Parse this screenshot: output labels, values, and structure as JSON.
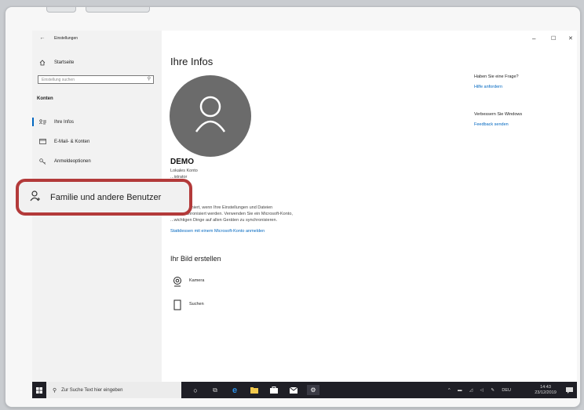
{
  "window": {
    "title": "Einstellungen",
    "back_icon": "←",
    "minimize": "–",
    "maximize": "☐",
    "close": "✕"
  },
  "sidebar": {
    "home_label": "Startseite",
    "search_placeholder": "Einstellung suchen",
    "section_label": "Konten",
    "items": [
      {
        "label": "Ihre Infos",
        "icon": "person-list-icon"
      },
      {
        "label": "E-Mail- & Konten",
        "icon": "mail-icon"
      },
      {
        "label": "Anmeldeoptionen",
        "icon": "key-icon"
      }
    ]
  },
  "main": {
    "title": "Ihre Infos",
    "account_name": "DEMO",
    "account_type": "Lokales Konto",
    "account_role": "...istrator",
    "info_line1": "...wird optimiert, wenn Ihre Einstellungen und Dateien",
    "info_line2": "...ch synchronisiert werden. Verwenden Sie ein Microsoft-Konto,",
    "info_line3": "...wichtigen Dinge auf allen Geräten zu synchronisieren.",
    "ms_link": "Stattdessen mit einem Microsoft-Konto anmelden",
    "picture_title": "Ihr Bild erstellen",
    "camera_label": "Kamera",
    "browse_label": "Suchen"
  },
  "right_panel": {
    "q_title": "Haben Sie eine Frage?",
    "q_link": "Hilfe anfordern",
    "improve_title": "Verbessern Sie Windows",
    "improve_link": "Feedback senden"
  },
  "callout": {
    "label": "Familie und andere Benutzer"
  },
  "taskbar": {
    "search_text": "Zur Suche Text hier eingeben",
    "language": "DEU",
    "time": "14:43",
    "date": "23/12/2019"
  },
  "colors": {
    "accent": "#0067c0",
    "highlight": "#b33a3a",
    "taskbar": "#1f1f26"
  }
}
